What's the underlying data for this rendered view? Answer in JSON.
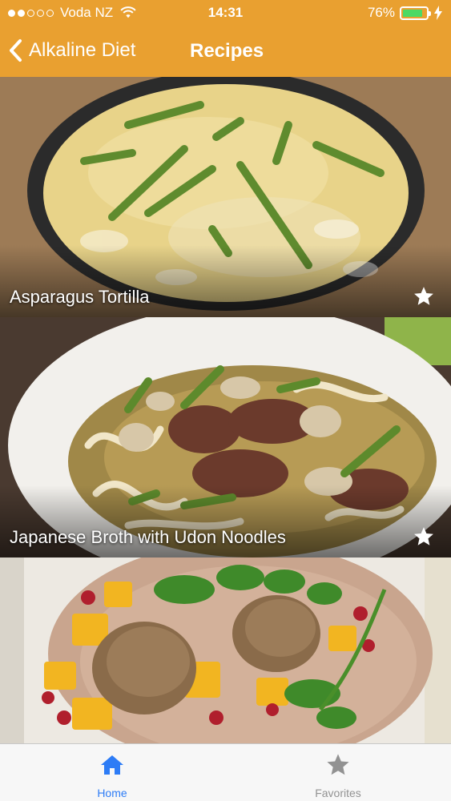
{
  "status_bar": {
    "carrier": "Voda NZ",
    "time": "14:31",
    "battery_percent": "76%",
    "battery_level": 0.76,
    "signal_dots_filled": 2,
    "signal_dots_total": 5,
    "battery_color": "#4CD964"
  },
  "nav": {
    "back_label": "Alkaline Diet",
    "title": "Recipes",
    "bar_color": "#E9A030"
  },
  "recipes": [
    {
      "title": "Asparagus Tortilla",
      "favorite_icon": "star-icon"
    },
    {
      "title": "Japanese Broth with Udon Noodles",
      "favorite_icon": "star-icon"
    },
    {
      "title": "",
      "favorite_icon": "star-icon"
    }
  ],
  "tabs": [
    {
      "label": "Home",
      "icon": "home-icon",
      "active": true,
      "color": "#2D7CF6"
    },
    {
      "label": "Favorites",
      "icon": "star-icon",
      "active": false,
      "color": "#929292"
    }
  ]
}
